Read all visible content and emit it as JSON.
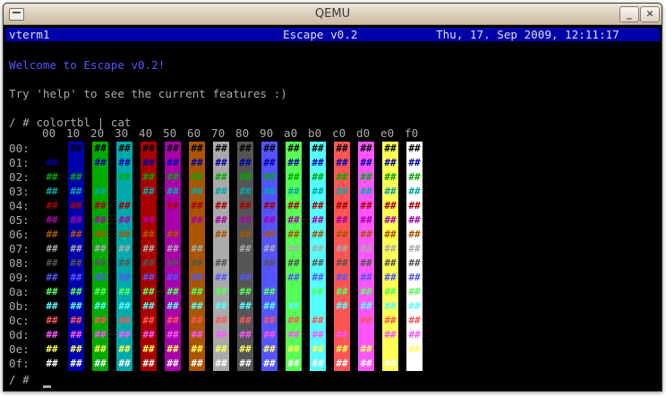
{
  "window": {
    "title": "QEMU",
    "minimize_label": "_",
    "close_label": "✕"
  },
  "statusbar": {
    "left": "vterm1",
    "center": "Escape v0.2",
    "right": "Thu, 17. Sep 2009, 12:11:17"
  },
  "terminal": {
    "welcome": "Welcome to Escape v0.2!",
    "help": "Try 'help' to see the current features :)",
    "command": "/ # colortbl | cat",
    "prompt": "/ #",
    "col_headers": [
      "00",
      "10",
      "20",
      "30",
      "40",
      "50",
      "60",
      "70",
      "80",
      "90",
      "a0",
      "b0",
      "c0",
      "d0",
      "e0",
      "f0"
    ],
    "row_labels": [
      "00:",
      "01:",
      "02:",
      "03:",
      "04:",
      "05:",
      "06:",
      "07:",
      "08:",
      "09:",
      "0a:",
      "0b:",
      "0c:",
      "0d:",
      "0e:",
      "0f:"
    ],
    "cell_glyph": "##",
    "palette": [
      "#000000",
      "#0000aa",
      "#00aa00",
      "#00aaaa",
      "#aa0000",
      "#aa00aa",
      "#aa5500",
      "#aaaaaa",
      "#555555",
      "#5555ff",
      "#55ff55",
      "#55ffff",
      "#ff5555",
      "#ff55ff",
      "#ffff55",
      "#ffffff"
    ]
  }
}
